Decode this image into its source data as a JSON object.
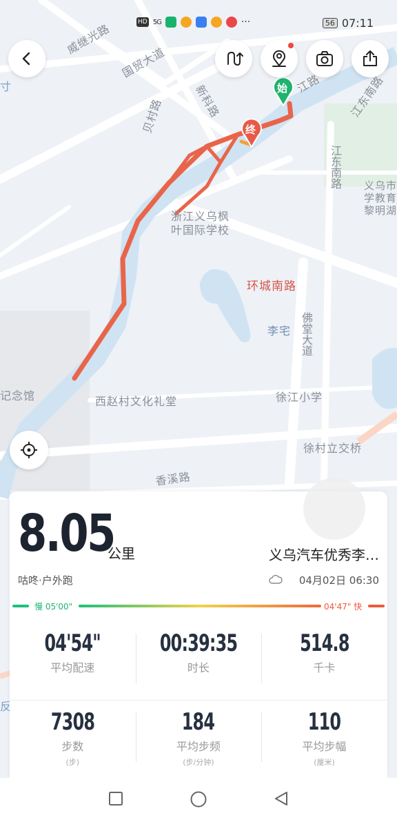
{
  "status_bar": {
    "hd": "HD",
    "signal": "5G",
    "dots": "···",
    "battery": "56",
    "time": "07:11"
  },
  "map": {
    "labels": {
      "weijiguang_road": "威继光路",
      "guomao_avenue": "国贸大道",
      "beicun_road": "贝村路",
      "xinke_road": "新科路",
      "jiang_road": "江路",
      "jiangdong_nan_road_top": "江东南路",
      "jiangdong_nan_road": "江东南路",
      "yiwu_city_edu": "义乌市\n学教育\n黎明湖",
      "school": "浙江义乌枫\n叶国际学校",
      "huancheng_nan_road": "环城南路",
      "lizhai": "李宅",
      "fotang_avenue": "佛堂大道",
      "jinianguan": "记念馆",
      "xizhaocun_hall": "西赵村文化礼堂",
      "xujiang_school": "徐江小学",
      "xucun_bridge": "徐村立交桥",
      "xiangxi_road": "香溪路",
      "left_edge_1": "寸",
      "left_edge_2": "反"
    },
    "start_marker": "始",
    "end_marker": "终"
  },
  "icons": {
    "back": "back-arrow-icon",
    "route_swap": "route-swap-icon",
    "location_pin": "location-pin-icon",
    "camera": "camera-icon",
    "share": "share-icon",
    "locate": "locate-crosshair-icon",
    "weather": "cloud-icon"
  },
  "summary": {
    "distance": "8.05",
    "distance_unit": "公里",
    "group_name": "义乌汽车优秀李…",
    "activity_type": "咕咚·户外跑",
    "date_time": "04月02日 06:30",
    "pace_slow": "慢 05'00\"",
    "pace_fast": "04'47\" 快",
    "colors": {
      "slow": "#1fc07a",
      "mid": "#f0d24a",
      "fast": "#ef5b3a",
      "route": "#e8654a"
    }
  },
  "stats": {
    "avg_pace": {
      "value": "04'54\"",
      "label": "平均配速"
    },
    "duration": {
      "value": "00:39:35",
      "label": "时长"
    },
    "calories": {
      "value": "514.8",
      "label": "千卡"
    },
    "steps": {
      "value": "7308",
      "label": "步数",
      "unit": "(步)"
    },
    "cadence": {
      "value": "184",
      "label": "平均步频",
      "unit": "(步/分钟)"
    },
    "stride": {
      "value": "110",
      "label": "平均步幅",
      "unit": "(厘米)"
    }
  }
}
